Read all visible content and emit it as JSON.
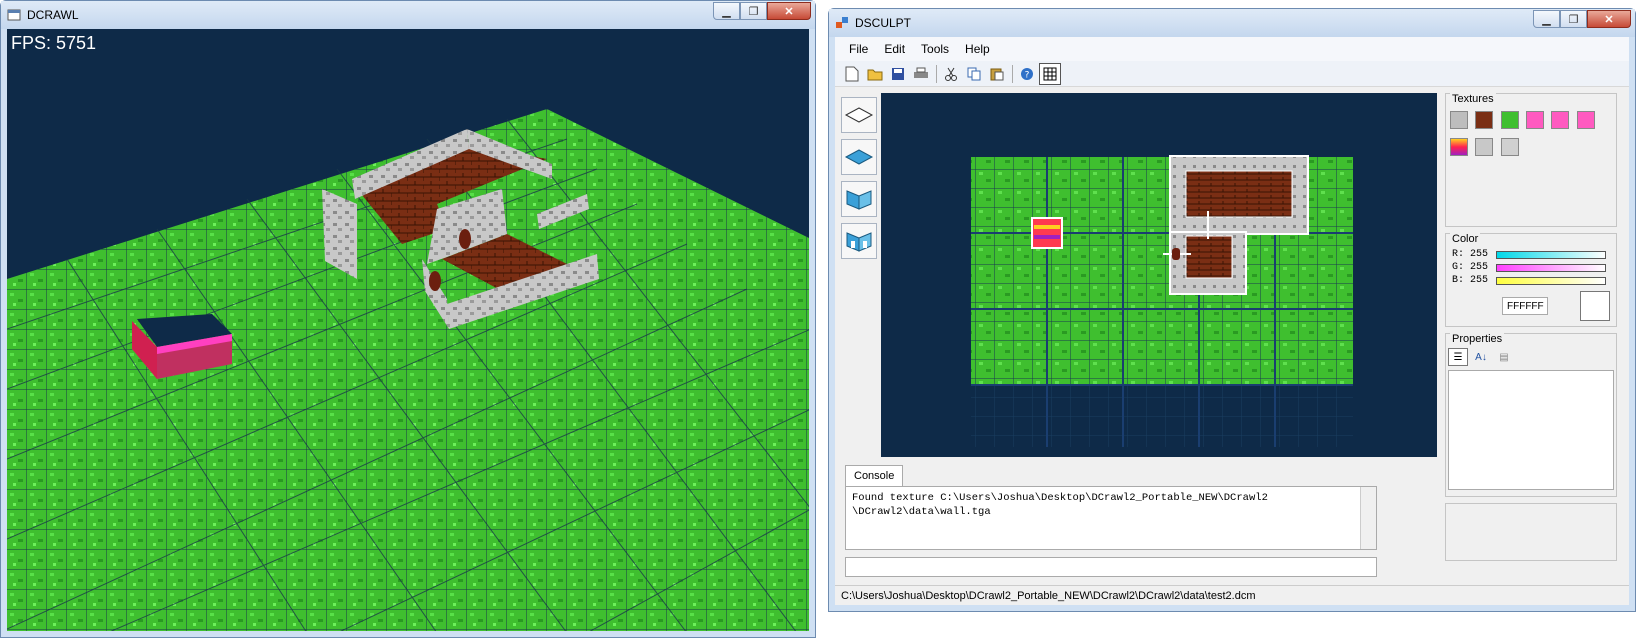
{
  "left_window": {
    "title": "DCRAWL",
    "fps_label": "FPS: 5751"
  },
  "right_window": {
    "title": "DSCULPT",
    "menu": [
      "File",
      "Edit",
      "Tools",
      "Help"
    ],
    "toolbar_icons": [
      "new-file-icon",
      "open-folder-icon",
      "save-icon",
      "print-icon",
      "cut-icon",
      "copy-icon",
      "paste-icon",
      "help-icon",
      "grid-toggle-icon"
    ],
    "tool_icons": [
      "floor-outline-icon",
      "floor-filled-icon",
      "wall-icon",
      "door-wall-icon"
    ],
    "panels": {
      "textures_title": "Textures",
      "color_title": "Color",
      "properties_title": "Properties"
    },
    "color": {
      "r_label": "R: 255",
      "g_label": "G: 255",
      "b_label": "B: 255",
      "hex": "FFFFFF",
      "r_bar": "#00d8e8",
      "g_bar": "#ff40ff",
      "b_bar": "#ffff40"
    },
    "console": {
      "tab_label": "Console",
      "line1": "Found texture C:\\Users\\Joshua\\Desktop\\DCrawl2_Portable_NEW\\DCrawl2",
      "line2": "\\DCrawl2\\data\\wall.tga"
    },
    "status_path": "C:\\Users\\Joshua\\Desktop\\DCrawl2_Portable_NEW\\DCrawl2\\DCrawl2\\data\\test2.dcm"
  },
  "colors": {
    "grass": "#3fbf2f",
    "sky": "#0e2a48",
    "brick": "#7a2e14",
    "stone": "#bdbdbd"
  }
}
